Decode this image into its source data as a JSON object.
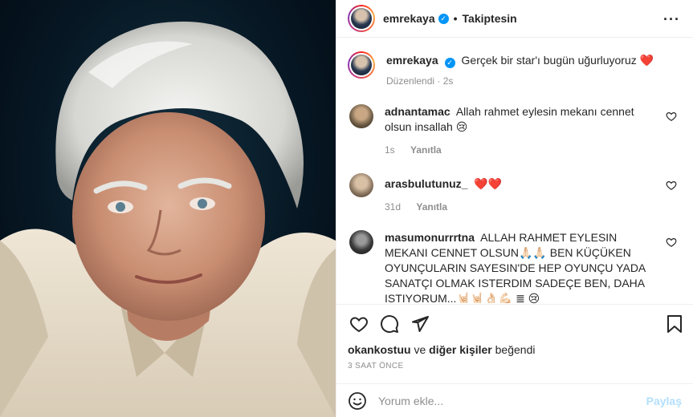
{
  "post_author": {
    "username": "emrekaya",
    "verified": true,
    "follow_status": "Takiptesin"
  },
  "caption": {
    "username": "emrekaya",
    "text": "Gerçek bir star'ı bugün uğurluyoruz ❤️",
    "edited": "Düzenlendi",
    "time": "2s"
  },
  "comments": [
    {
      "username": "adnantamac",
      "text": "Allah rahmet eylesin mekanı cennet olsun insallah 😢",
      "time": "1s",
      "reply_label": "Yanıtla",
      "avatar_color": "#6b5a44"
    },
    {
      "username": "arasbulutunuz_",
      "text": "❤️❤️",
      "time": "31d",
      "reply_label": "Yanıtla",
      "avatar_color": "#8a7560"
    },
    {
      "username": "masumonurrrtna",
      "text": "ALLAH RAHMET EYLESIN MEKANI CENNET OLSUN🙏🏻🙏🏻 BEN KÜÇÜKEN OYUNÇULARIN SAYESIN'DE HEP OYUNÇU YADA SANATÇI OLMAK ISTERDIM SADEÇE BEN, DAHA ISTIYORUM...🤘🏻🤘🏻👌🏻💪🏻 ≣ 😢",
      "avatar_color": "#3a3a3a"
    }
  ],
  "likes": {
    "user": "okankostuu",
    "connector": "ve",
    "others": "diğer kişiler",
    "suffix": "beğendi"
  },
  "timestamp": "3 SAAT ÖNCE",
  "add_comment": {
    "placeholder": "Yorum ekle...",
    "post_label": "Paylaş"
  },
  "icons": [
    "more-icon",
    "heart-icon",
    "comment-icon",
    "share-icon",
    "save-icon",
    "emoji-icon"
  ],
  "colors": {
    "accent": "#0095f6",
    "post_disabled": "#b2dffc",
    "muted": "#8e8e8e"
  }
}
